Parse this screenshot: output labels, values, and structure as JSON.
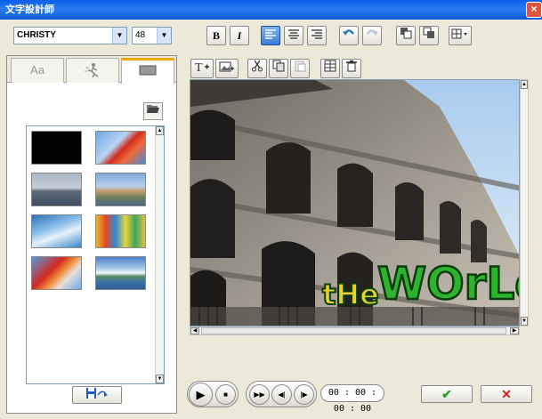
{
  "window": {
    "title": "文字設計師",
    "close_glyph": "×"
  },
  "toolbar": {
    "font_name": "CHRISTY",
    "font_size": "48",
    "bold_label": "B",
    "italic_label": "I",
    "icons": [
      "align-left-icon",
      "align-center-icon",
      "align-right-icon",
      "undo-icon",
      "redo-icon",
      "layer-back-icon",
      "layer-front-icon",
      "grid-menu-icon"
    ]
  },
  "left_panel": {
    "tabs": [
      {
        "label": "Aa",
        "icon": "font-style-icon"
      },
      {
        "label": "",
        "icon": "figure-motion-icon"
      },
      {
        "label": "",
        "icon": "background-icon"
      }
    ],
    "active_tab": 2,
    "thumbnails": [
      "black",
      "red-leaves",
      "city-river",
      "castle-bridge",
      "waterfall-blue",
      "colorful-street",
      "red-leaves-2",
      "mountain-lake"
    ]
  },
  "preview": {
    "title_text": "tHe WOrLd",
    "text_colors": {
      "the": "#E8D22A",
      "world": "#2DB32D",
      "outline": "#0B3D0B"
    },
    "icons": [
      "add-text-icon",
      "add-image-icon",
      "cut-icon",
      "copy-icon",
      "paste-icon",
      "align-icon",
      "delete-icon"
    ]
  },
  "player": {
    "timecode": "00 : 00 : 00 : 00",
    "ok_glyph": "✔",
    "cancel_glyph": "✕",
    "ok_color": "#2E9E2E",
    "cancel_color": "#D02020"
  }
}
